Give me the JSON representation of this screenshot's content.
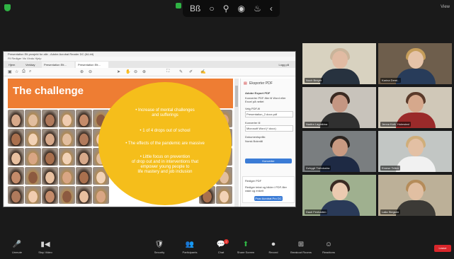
{
  "top": {
    "view_label": "View"
  },
  "annotation_toolbar": {
    "items": [
      "Bß",
      "○",
      "⚲",
      "◉",
      "♨",
      "‹"
    ]
  },
  "shared_app": {
    "title": "Presentation Ett prosjekt for alle - Adobe Acrobat Reader DC (64-bit)",
    "menu": "Fil  Rediger  Vis  Vindu  Hjelp",
    "tabs": [
      "Hjem",
      "Verktøy",
      "Presentation Ett...",
      "Presentation Ett..."
    ],
    "signin": "Logg på"
  },
  "slide": {
    "title": "The challenge",
    "bullets": [
      "• Increase of mental challenges\nand sufferings",
      "• 1 of 4 drops out of school",
      "• The effects of the pandemic are massive",
      "• Little focus on prevention\nof drop out and in interventions that\nempower young people to\nlife mastery and job inclusion"
    ],
    "colors": {
      "banner": "#ee7d33",
      "circle": "#f5be1b"
    }
  },
  "panel": {
    "header": "Eksporter PDF",
    "subheader": "Adobe Export PDF",
    "desc": "Konverter PDF-filer til Word eller Excel på nettet",
    "select_label": "Velg PDF-fil",
    "select_value": "Presentation_2.docx.pdf",
    "convert_label": "Konverter til",
    "convert_value": "Microsoft Word (*.docx)",
    "language_label": "Dokumentspråk:",
    "language_value": "Norsk Bokmål",
    "button": "Konverter",
    "promo_title": "Rediger PDF",
    "promo_desc": "Rediger tekst og bilder i PDF-filer raskt og enkelt",
    "promo_button": "Prøv Acrobat Pro DC"
  },
  "participants": [
    {
      "name": "Noch Breyer",
      "tile": "#8a8f8c",
      "bg": "#d8d2c0",
      "skin": "#e1bba3",
      "hair": "#c9b49a",
      "shirt": "#27323f"
    },
    {
      "name": "Karina Demi...",
      "tile": "#6e6258",
      "bg": "#6e5e4c",
      "skin": "#e5c3a8",
      "hair": "#c59d5a",
      "shirt": "#283c5a"
    },
    {
      "name": "Nadira Lagotkina",
      "tile": "#3e3e3e",
      "bg": "#c8c3bb",
      "skin": "#c49682",
      "hair": "#3a2a22",
      "shirt": "#303030"
    },
    {
      "name": "Jenna Kalk, Holmsted",
      "tile": "#a8a090",
      "bg": "#d0c8b8",
      "skin": "#d6a88c",
      "hair": "#5a3a2a",
      "shirt": "#9a2a2a"
    },
    {
      "name": "Dzhygit Trehdusha",
      "tile": "#5a5e60",
      "bg": "#7a7e80",
      "skin": "#c99a82",
      "hair": "#2a2420",
      "shirt": "#1e2a44"
    },
    {
      "name": "Emese Tellen",
      "tile": "#9aa0a2",
      "bg": "#c2c6c4",
      "skin": "#e3c0a4",
      "hair": "#d0ae7a",
      "shirt": "#f1f1f1"
    },
    {
      "name": "Daoli Fenharten",
      "tile": "#7f8e7a",
      "bg": "#9fb08f",
      "skin": "#ebcab0",
      "hair": "#3a2a22",
      "shirt": "#2a3a58"
    },
    {
      "name": "Laila Stegsen",
      "tile": "#aa9e88",
      "bg": "#bcb098",
      "skin": "#e1bfa2",
      "hair": "#b58c5a",
      "shirt": "#3c3a36"
    }
  ],
  "controls": [
    {
      "icon": "🎤",
      "label": "Unmute"
    },
    {
      "icon": "▮◀",
      "label": "Stop Video"
    },
    {
      "icon": "🛡",
      "label": "Security"
    },
    {
      "icon": "👥",
      "label": "Participants"
    },
    {
      "icon": "💬",
      "label": "Chat"
    },
    {
      "icon": "⬆",
      "label": "Share Screen"
    },
    {
      "icon": "⏺",
      "label": "Record"
    },
    {
      "icon": "⊞",
      "label": "Breakout Rooms"
    },
    {
      "icon": "☺",
      "label": "Reactions"
    }
  ],
  "leave_label": "Leave",
  "chat_badge": "2"
}
